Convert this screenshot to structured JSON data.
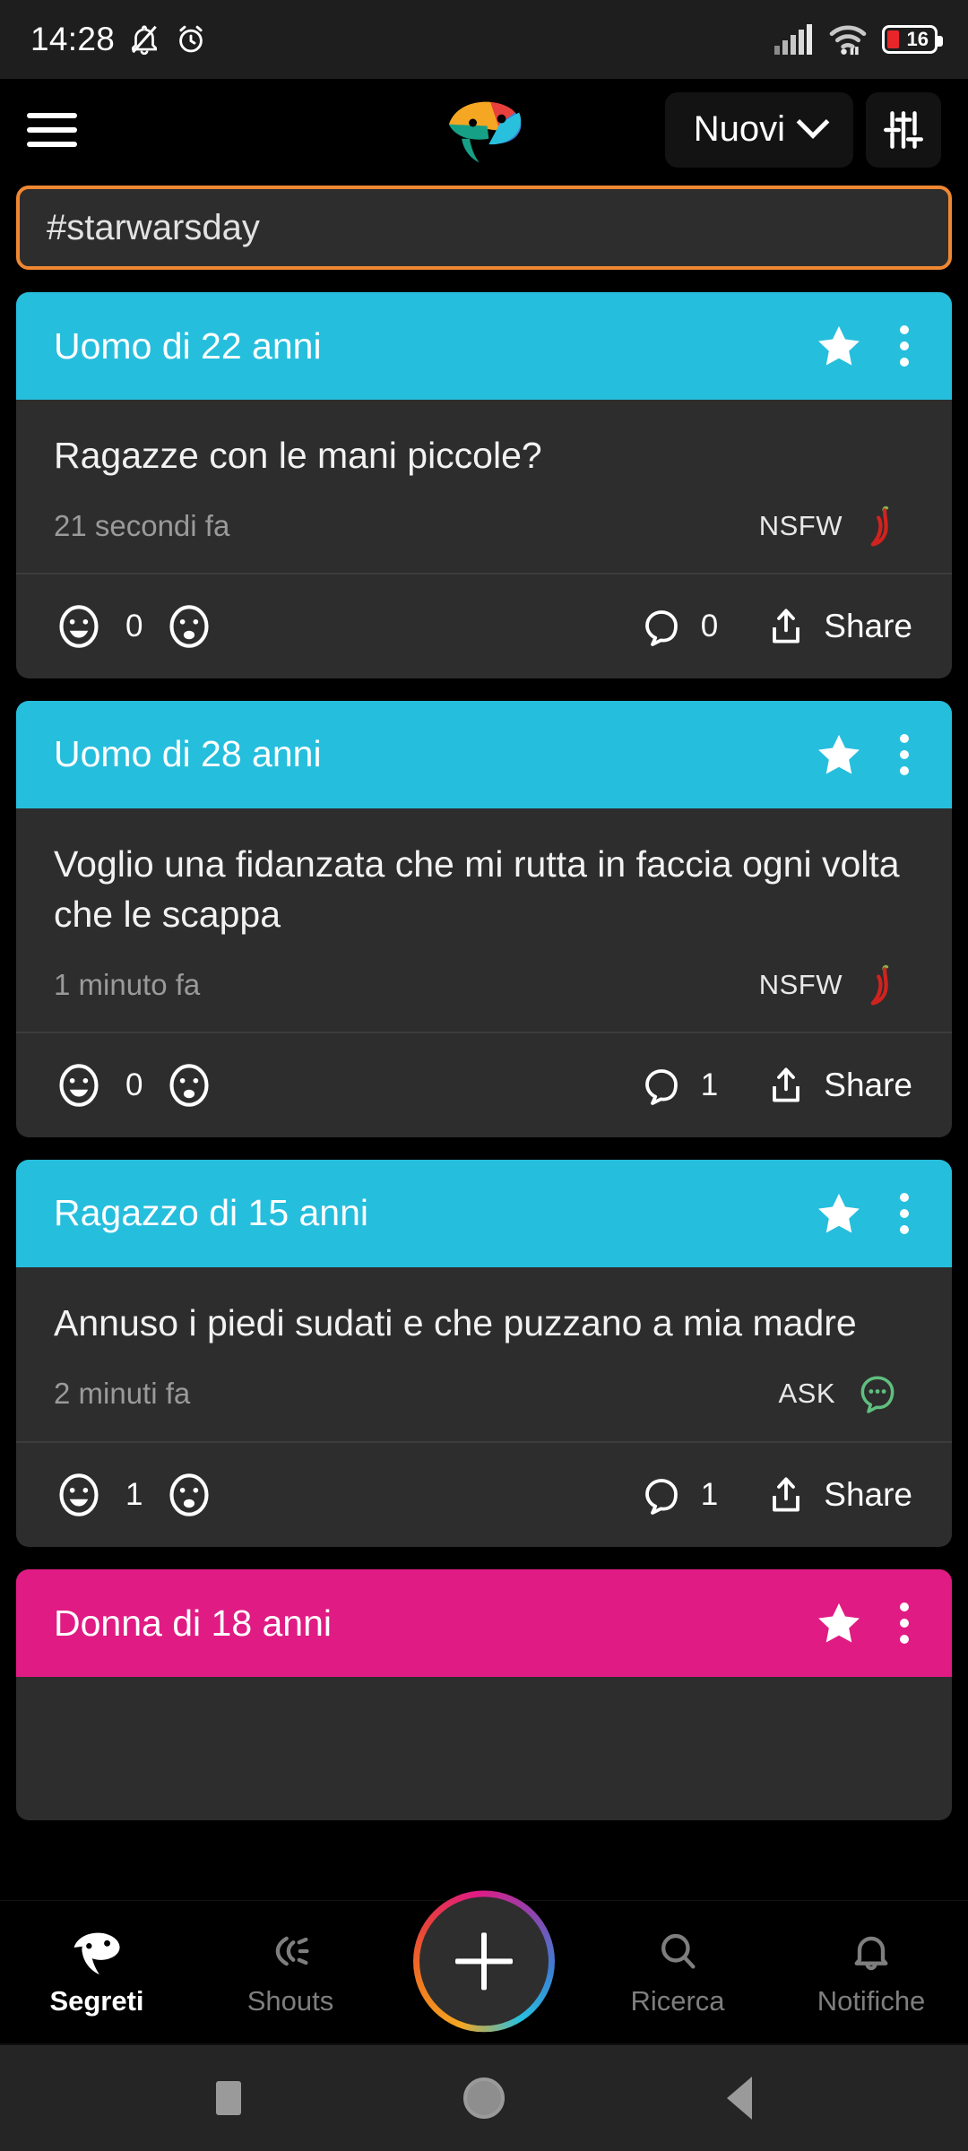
{
  "status_bar": {
    "time": "14:28",
    "icons": [
      "bell-muted-icon",
      "alarm-icon",
      "signal-icon",
      "wifi-icon"
    ],
    "battery_percent": "16"
  },
  "header": {
    "menu_icon": "hamburger-menu-icon",
    "logo": "parrot-logo",
    "sort_label": "Nuovi",
    "sort_chevron": "chevron-down-icon",
    "filter_icon": "sliders-filter-icon"
  },
  "tag_card": {
    "text": "#starwarsday",
    "border_color": "#f08732"
  },
  "colors": {
    "male": "#26bedd",
    "female": "#e01b84",
    "card_bg": "#2d2d2d",
    "page_bg": "#000000",
    "nsfw": "#d0231f",
    "ask": "#5fbf7f"
  },
  "posts": [
    {
      "author": "Uomo di 22 anni",
      "header_color": "#26bedd",
      "text": "Ragazze con le mani piccole?",
      "time": "21 secondi fa",
      "badge_label": "NSFW",
      "badge_icon": "chili-pepper-icon",
      "likes": "0",
      "comments": "0",
      "share_label": "Share"
    },
    {
      "author": "Uomo di 28 anni",
      "header_color": "#26bedd",
      "text": "Voglio una fidanzata che mi rutta in faccia ogni volta che le scappa",
      "time": "1 minuto fa",
      "badge_label": "NSFW",
      "badge_icon": "chili-pepper-icon",
      "likes": "0",
      "comments": "1",
      "share_label": "Share"
    },
    {
      "author": "Ragazzo di 15 anni",
      "header_color": "#26bedd",
      "text": "Annuso i piedi sudati e che puzzano a mia madre",
      "time": "2 minuti fa",
      "badge_label": "ASK",
      "badge_icon": "speech-bubble-dots-icon",
      "likes": "1",
      "comments": "1",
      "share_label": "Share"
    },
    {
      "author": "Donna di 18 anni",
      "header_color": "#e01b84",
      "text": "",
      "time": "",
      "badge_label": "",
      "badge_icon": "",
      "likes": "",
      "comments": "",
      "share_label": ""
    }
  ],
  "bottom_nav": {
    "items": [
      {
        "label": "Segreti",
        "icon": "parrot-icon",
        "active": true
      },
      {
        "label": "Shouts",
        "icon": "megaphone-icon",
        "active": false
      },
      {
        "label": "Ricerca",
        "icon": "search-icon",
        "active": false
      },
      {
        "label": "Notifiche",
        "icon": "bell-icon",
        "active": false
      }
    ],
    "fab_icon": "plus-icon"
  },
  "android_nav": {
    "recents": "square-recents-icon",
    "home": "circle-home-icon",
    "back": "triangle-back-icon"
  }
}
